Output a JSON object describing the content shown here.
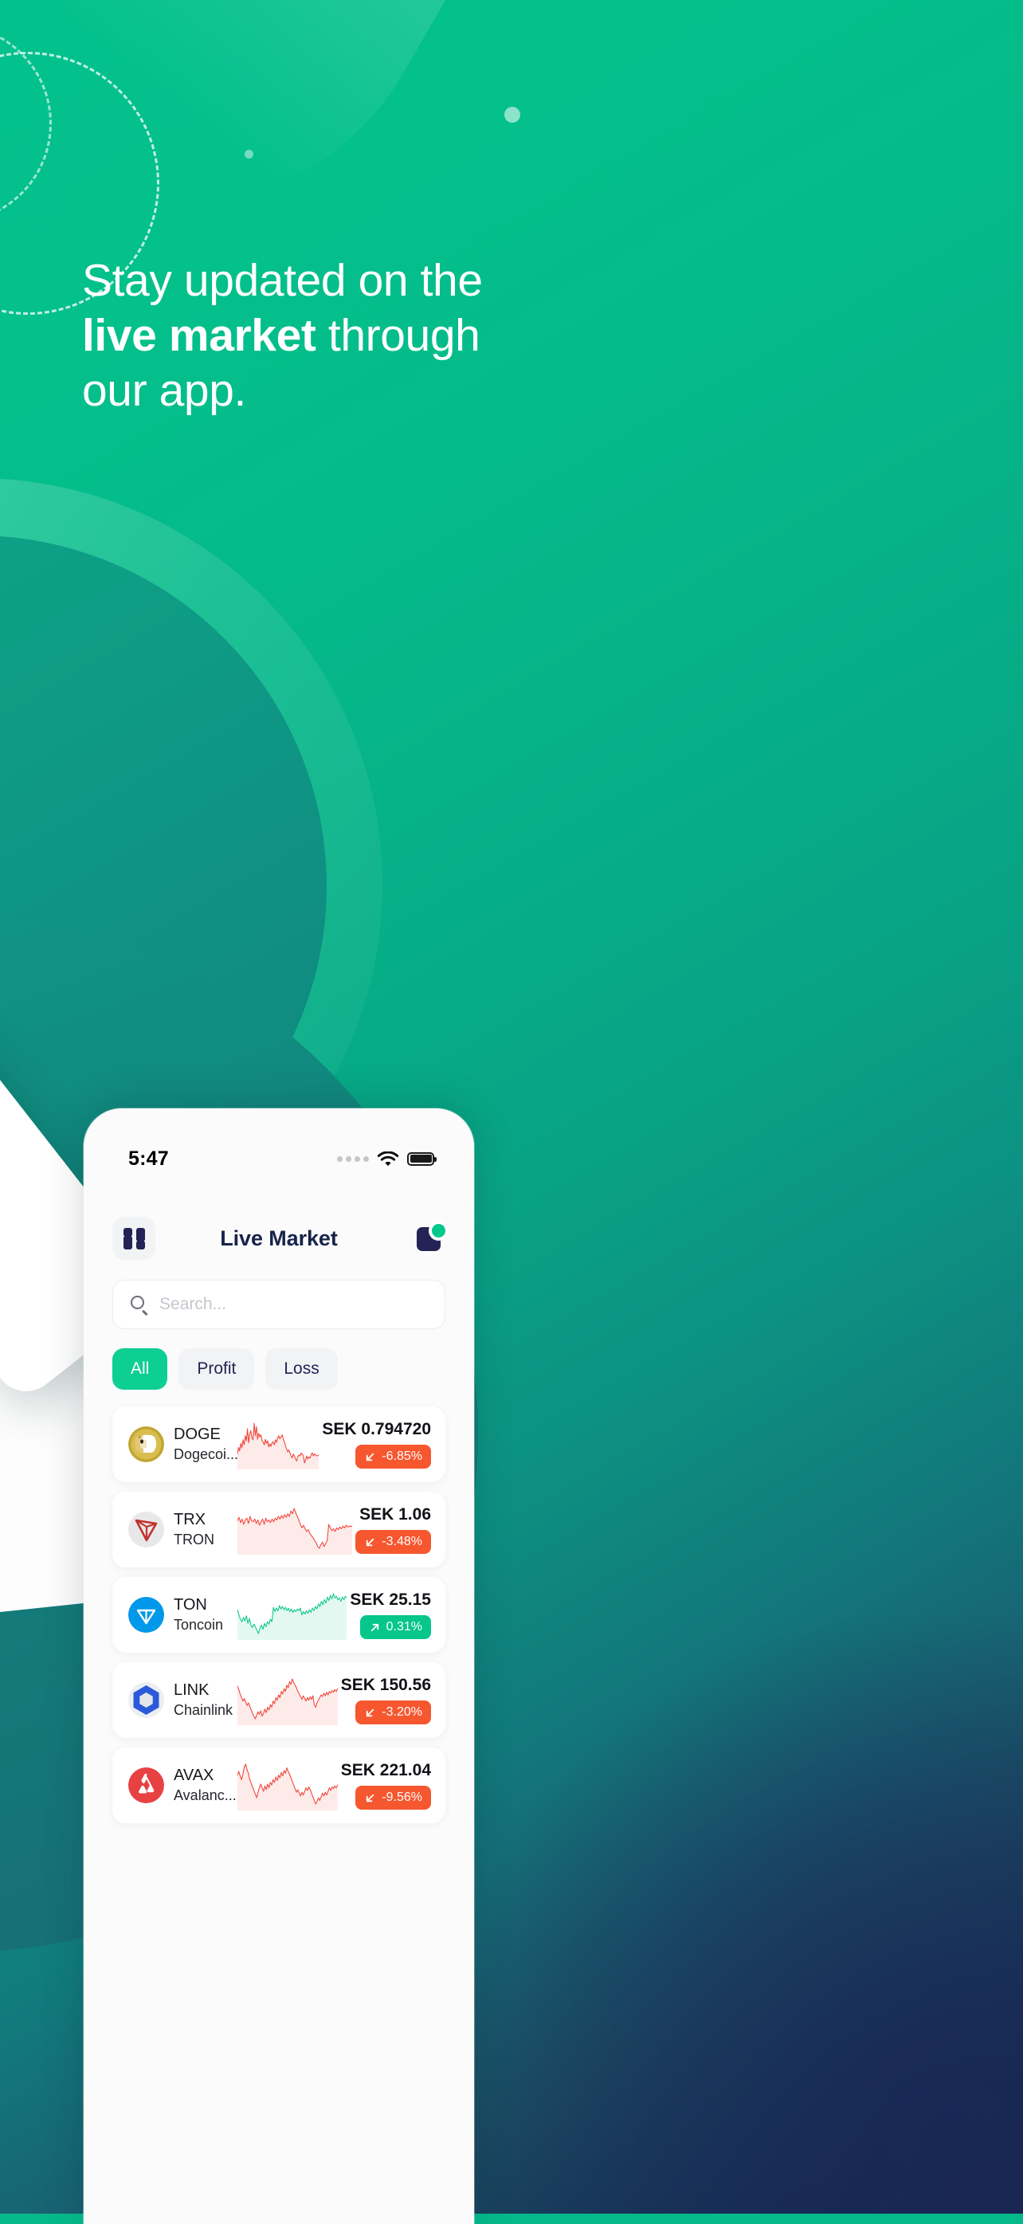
{
  "hero": {
    "line1": "Stay updated on the",
    "line2_bold": "live market",
    "line2_rest": " through",
    "line3": "our app."
  },
  "phone": {
    "status_bar": {
      "time": "5:47",
      "signal_icon": "signal-dots-icon",
      "wifi_icon": "wifi-icon",
      "battery_icon": "battery-full-icon"
    },
    "header": {
      "grid_icon": "grid-menu-icon",
      "title": "Live Market",
      "notification_icon": "notification-badge-icon"
    },
    "search": {
      "placeholder": "Search...",
      "value": "",
      "icon": "search-icon"
    },
    "filters": [
      {
        "label": "All",
        "active": true
      },
      {
        "label": "Profit",
        "active": false
      },
      {
        "label": "Loss",
        "active": false
      }
    ],
    "coins": [
      {
        "symbol": "DOGE",
        "name": "Dogecoi...",
        "price": "SEK 0.794720",
        "change": "-6.85%",
        "direction": "down",
        "avatar_icon": "dogecoin-logo",
        "avatar_color": "#c2a633"
      },
      {
        "symbol": "TRX",
        "name": "TRON",
        "price": "SEK 1.06",
        "change": "-3.48%",
        "direction": "down",
        "avatar_icon": "tron-logo",
        "avatar_color": "#e8e8ea"
      },
      {
        "symbol": "TON",
        "name": "Toncoin",
        "price": "SEK 25.15",
        "change": "0.31%",
        "direction": "up",
        "avatar_icon": "toncoin-logo",
        "avatar_color": "#0098ea"
      },
      {
        "symbol": "LINK",
        "name": "Chainlink",
        "price": "SEK 150.56",
        "change": "-3.20%",
        "direction": "down",
        "avatar_icon": "chainlink-logo",
        "avatar_color": "#2a5ada"
      },
      {
        "symbol": "AVAX",
        "name": "Avalanc...",
        "price": "SEK 221.04",
        "change": "-9.56%",
        "direction": "down",
        "avatar_icon": "avalanche-logo",
        "avatar_color": "#e84142"
      }
    ]
  },
  "colors": {
    "brand_green": "#0ecf92",
    "loss_red": "#f7572f",
    "profit_green": "#06c68a",
    "navy": "#252355",
    "title_navy": "#17244a"
  },
  "chart_data": {
    "type": "line",
    "title": "Coin 7-day price sparklines",
    "xlabel": "",
    "ylabel": "",
    "grid": false,
    "legend": "none",
    "series": [
      {
        "name": "DOGE",
        "color": "#f0483c",
        "trend": "down",
        "values": [
          34,
          47,
          40,
          55,
          46,
          62,
          52,
          70,
          60,
          84,
          56,
          74,
          80,
          66,
          62,
          95,
          70,
          88,
          63,
          75,
          68,
          72,
          60,
          58,
          52,
          63,
          55,
          60,
          48,
          54,
          49,
          56,
          58,
          52,
          62,
          57,
          66,
          70,
          64,
          68,
          72,
          64,
          58,
          50,
          44,
          38,
          42,
          36,
          30,
          26,
          34,
          30,
          24,
          20,
          28,
          32,
          30,
          36,
          33,
          31,
          16,
          22,
          30,
          24,
          28,
          26,
          33,
          36,
          30,
          34,
          32,
          30,
          31,
          33
        ]
      },
      {
        "name": "TRX",
        "color": "#f0483c",
        "trend": "down",
        "values": [
          68,
          76,
          64,
          72,
          60,
          70,
          74,
          62,
          78,
          68,
          66,
          72,
          62,
          70,
          58,
          66,
          72,
          60,
          74,
          66,
          70,
          64,
          72,
          66,
          74,
          70,
          78,
          72,
          80,
          74,
          82,
          76,
          84,
          78,
          90,
          84,
          96,
          86,
          78,
          70,
          60,
          52,
          58,
          50,
          44,
          48,
          40,
          34,
          30,
          24,
          18,
          10,
          6,
          14,
          20,
          10,
          16,
          24,
          60,
          52,
          46,
          50,
          44,
          52,
          48,
          54,
          50,
          56,
          52,
          58,
          54,
          56,
          55,
          57
        ]
      },
      {
        "name": "TON",
        "color": "#12c98c",
        "trend": "up",
        "values": [
          62,
          50,
          40,
          34,
          44,
          36,
          48,
          30,
          42,
          26,
          20,
          28,
          22,
          14,
          6,
          18,
          26,
          16,
          30,
          22,
          34,
          28,
          40,
          34,
          68,
          58,
          66,
          60,
          72,
          64,
          70,
          62,
          68,
          60,
          66,
          58,
          64,
          56,
          62,
          58,
          64,
          60,
          66,
          50,
          58,
          52,
          60,
          54,
          62,
          56,
          66,
          60,
          70,
          64,
          76,
          70,
          82,
          74,
          86,
          78,
          92,
          84,
          96,
          88,
          100,
          90,
          94,
          86,
          90,
          82,
          92,
          86,
          94,
          90
        ]
      },
      {
        "name": "LINK",
        "color": "#f0483c",
        "trend": "down",
        "values": [
          82,
          74,
          64,
          56,
          48,
          54,
          46,
          38,
          44,
          36,
          28,
          20,
          14,
          8,
          16,
          24,
          18,
          26,
          14,
          20,
          30,
          22,
          34,
          28,
          40,
          34,
          48,
          42,
          56,
          50,
          62,
          56,
          70,
          64,
          76,
          70,
          84,
          78,
          92,
          86,
          98,
          90,
          84,
          78,
          70,
          64,
          58,
          52,
          60,
          54,
          48,
          56,
          50,
          58,
          52,
          60,
          40,
          34,
          44,
          50,
          56,
          62,
          58,
          66,
          60,
          68,
          62,
          70,
          66,
          72,
          68,
          74,
          70,
          76
        ]
      },
      {
        "name": "AVAX",
        "color": "#f0483c",
        "trend": "down",
        "values": [
          72,
          80,
          70,
          62,
          74,
          90,
          96,
          84,
          76,
          62,
          54,
          46,
          38,
          30,
          22,
          34,
          44,
          52,
          44,
          36,
          48,
          40,
          52,
          44,
          56,
          50,
          62,
          56,
          68,
          60,
          72,
          66,
          78,
          70,
          82,
          76,
          88,
          80,
          74,
          66,
          58,
          50,
          42,
          34,
          40,
          32,
          26,
          34,
          28,
          36,
          44,
          38,
          46,
          40,
          32,
          24,
          16,
          8,
          14,
          22,
          16,
          24,
          32,
          26,
          34,
          28,
          36,
          44,
          38,
          46,
          42,
          48,
          44,
          50
        ]
      }
    ]
  }
}
